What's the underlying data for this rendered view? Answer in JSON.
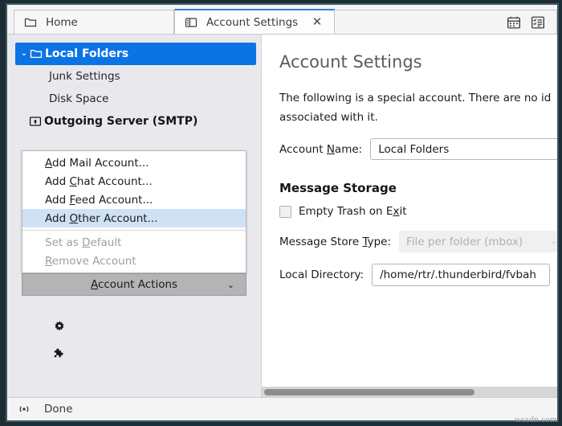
{
  "window": {
    "tabs": [
      {
        "label": "Home",
        "icon": "folder-icon",
        "active": false
      },
      {
        "label": "Account Settings",
        "icon": "panel-layout-icon",
        "active": true
      }
    ],
    "close_glyph": "✕",
    "strip_icons": [
      "calendar-icon",
      "tasks-icon"
    ]
  },
  "sidebar": {
    "tree": [
      {
        "label": "Local Folders",
        "icon": "folder-icon",
        "selected": true,
        "twisty": "⌄"
      },
      {
        "label": "Junk Settings",
        "icon": "",
        "selected": false
      },
      {
        "label": "Disk Space",
        "icon": "",
        "selected": false
      },
      {
        "label": "Outgoing Server (SMTP)",
        "icon": "outgoing-server-icon",
        "selected": false
      }
    ],
    "menu": {
      "items": [
        {
          "label": "Add Mail Account...",
          "mnemonic": "A",
          "state": "normal"
        },
        {
          "label": "Add Chat Account...",
          "mnemonic": "C",
          "state": "normal"
        },
        {
          "label": "Add Feed Account...",
          "mnemonic": "F",
          "state": "normal"
        },
        {
          "label": "Add Other Account...",
          "mnemonic": "O",
          "state": "highlighted"
        },
        {
          "label": "Set as Default",
          "mnemonic": "D",
          "state": "disabled"
        },
        {
          "label": "Remove Account",
          "mnemonic": "R",
          "state": "disabled"
        }
      ],
      "highlight_color": "#cfe1f5"
    },
    "account_actions_button": {
      "label": "Account Actions",
      "mnemonic": "A",
      "chevron": "⌄"
    },
    "tools": [
      {
        "name": "settings-gear-icon"
      },
      {
        "name": "addons-puzzle-icon"
      }
    ],
    "selection_color": "#0b74e5"
  },
  "content": {
    "title": "Account Settings",
    "description_line_1": "The following is a special account. There are no id",
    "description_line_2": "associated with it.",
    "account_name_label": "Account Name:",
    "account_name_mnemonic": "N",
    "account_name_value": "Local Folders",
    "section_message_storage": "Message Storage",
    "empty_trash_label": "Empty Trash on Exit",
    "empty_trash_mnemonic": "x",
    "empty_trash_checked": false,
    "store_type_label": "Message Store Type:",
    "store_type_mnemonic": "T",
    "store_type_value": "File per folder (mbox)",
    "store_type_caret": "⌄",
    "local_directory_label": "Local Directory:",
    "local_directory_value": "/home/rtr/.thunderbird/fvbah"
  },
  "status": {
    "icon": "connection-signal-icon",
    "text": "Done"
  },
  "watermark": "wsxdn.com"
}
